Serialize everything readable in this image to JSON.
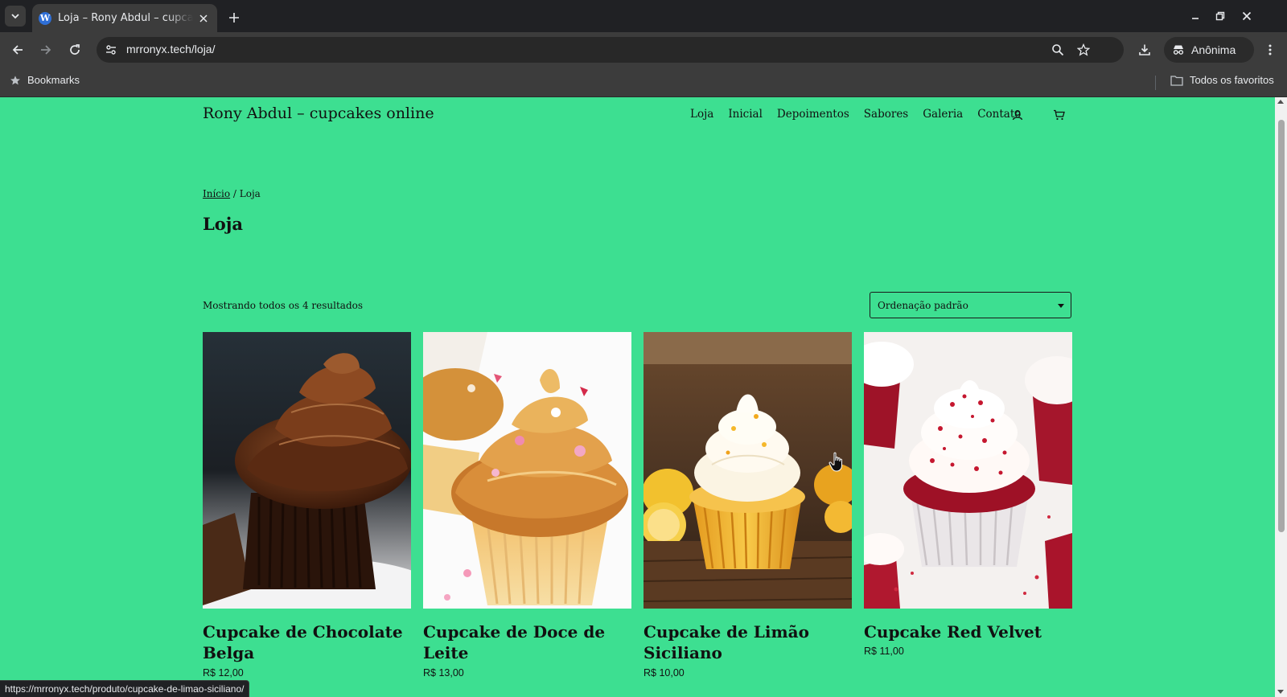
{
  "browser": {
    "tab": {
      "title": "Loja – Rony Abdul – cupcakes online"
    },
    "url": "mrronyx.tech/loja/",
    "profile_label": "Anônima",
    "bookmarks": {
      "left_label": "Bookmarks",
      "right_label": "Todos os favoritos"
    },
    "status_url": "https://mrronyx.tech/produto/cupcake-de-limao-siciliano/"
  },
  "site": {
    "title": "Rony Abdul – cupcakes online",
    "nav": [
      "Loja",
      "Inicial",
      "Depoimentos",
      "Sabores",
      "Galeria",
      "Contato"
    ],
    "background": "#3ddf91"
  },
  "shop": {
    "breadcrumb_home": "Início",
    "breadcrumb_sep": " / ",
    "breadcrumb_current": "Loja",
    "page_title": "Loja",
    "result_count": "Mostrando todos os 4 resultados",
    "ordering": "Ordenação padrão",
    "products": [
      {
        "name": "Cupcake de Chocolate Belga",
        "price": "R$ 12,00"
      },
      {
        "name": "Cupcake de Doce de Leite",
        "price": "R$ 13,00"
      },
      {
        "name": "Cupcake de Limão Siciliano",
        "price": "R$ 10,00"
      },
      {
        "name": "Cupcake Red Velvet",
        "price": "R$ 11,00"
      }
    ]
  }
}
